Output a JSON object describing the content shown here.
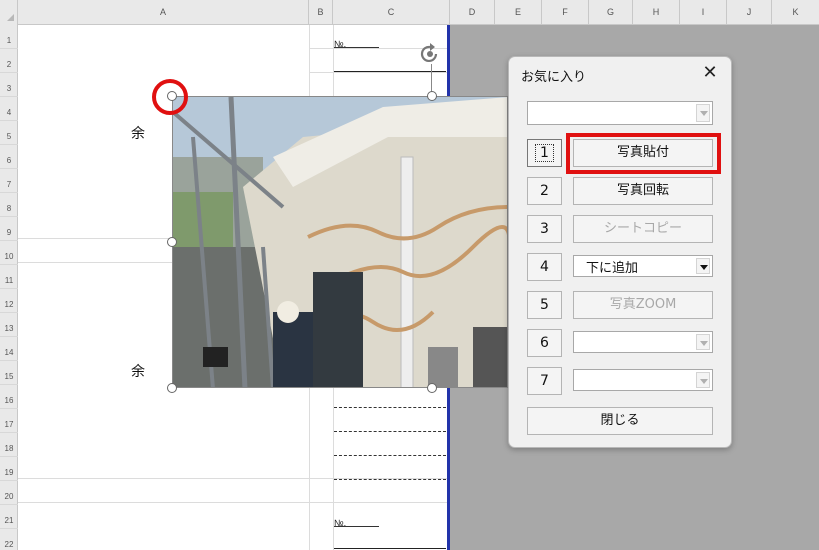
{
  "columns": [
    "A",
    "B",
    "C",
    "D",
    "E",
    "F",
    "G",
    "H",
    "I",
    "J",
    "K"
  ],
  "rows": [
    "1",
    "2",
    "3",
    "4",
    "5",
    "6",
    "7",
    "8",
    "9",
    "10",
    "11",
    "12",
    "13",
    "14",
    "15",
    "16",
    "17",
    "18",
    "19",
    "20",
    "21",
    "22"
  ],
  "sheet": {
    "cell_a4": "余",
    "cell_a14": "余",
    "no_label_top": "№.",
    "no_label_bottom": "№."
  },
  "photo": {
    "icon": "photo-image",
    "colors": {
      "sky": "#b6c8d8",
      "wall": "#ddd9cc",
      "crack": "#c79a6a",
      "scaffold": "#7c8288"
    }
  },
  "dialog": {
    "title": "お気に入り",
    "close_symbol": "✕",
    "top_combo_value": "",
    "rows": [
      {
        "number": "1",
        "action": "写真貼付",
        "type": "button",
        "enabled": true
      },
      {
        "number": "2",
        "action": "写真回転",
        "type": "button",
        "enabled": true
      },
      {
        "number": "3",
        "action": "シートコピー",
        "type": "button",
        "enabled": false
      },
      {
        "number": "4",
        "action": "下に追加",
        "type": "combo",
        "enabled": true
      },
      {
        "number": "5",
        "action": "写真ZOOM",
        "type": "button",
        "enabled": false
      },
      {
        "number": "6",
        "action": "",
        "type": "combo",
        "enabled": false
      },
      {
        "number": "7",
        "action": "",
        "type": "combo",
        "enabled": false
      }
    ],
    "close_button": "閉じる"
  },
  "highlight_color": "#e01010",
  "print_border_color": "#2233aa"
}
